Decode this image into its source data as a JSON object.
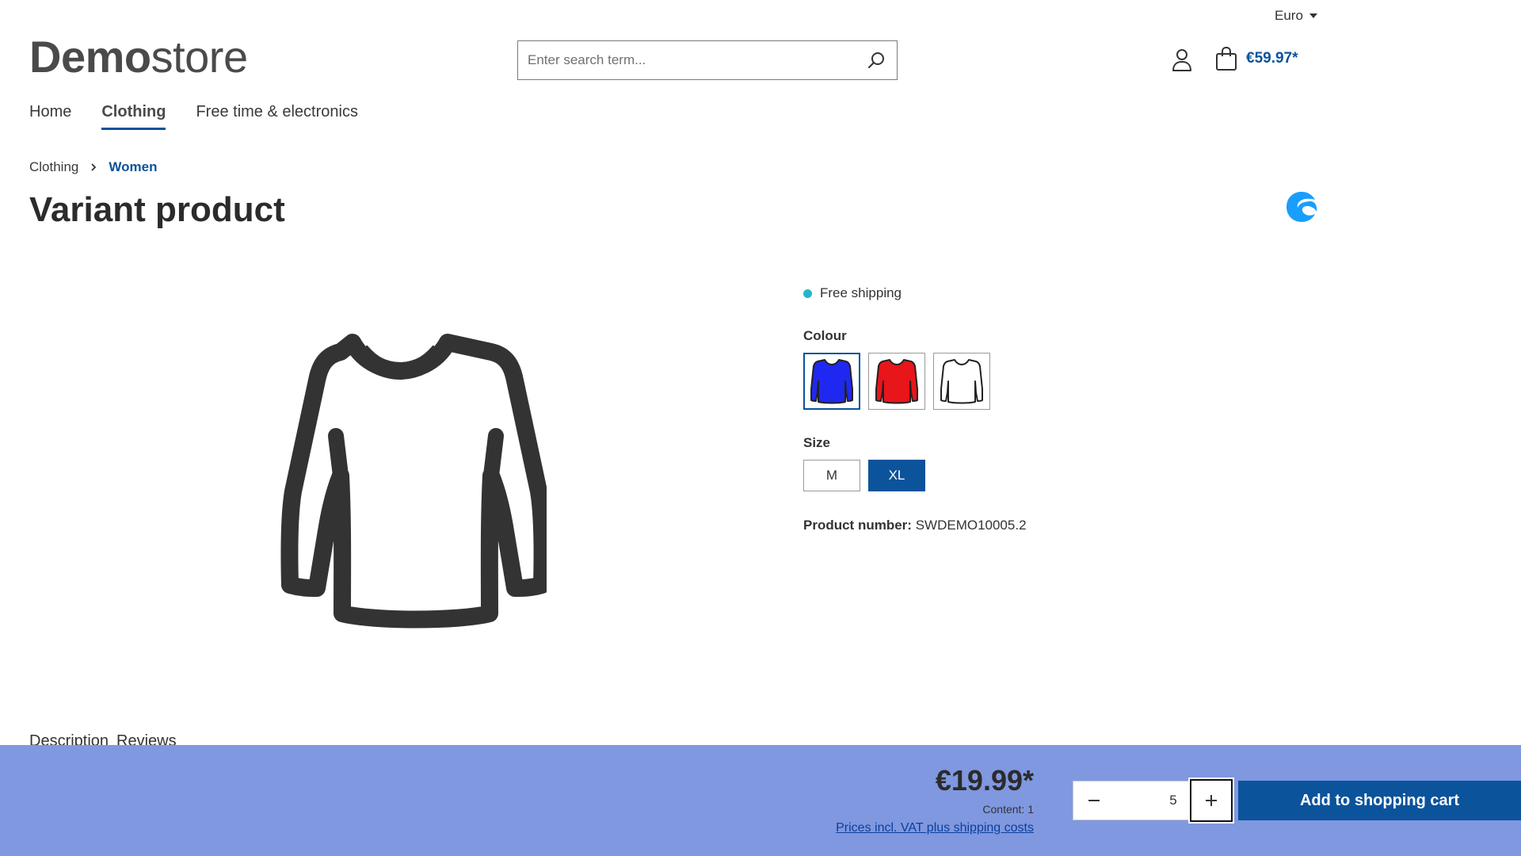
{
  "header": {
    "currency_label": "Euro",
    "logo_bold": "Demo",
    "logo_light": "store",
    "search_placeholder": "Enter search term...",
    "cart_total": "€59.97*"
  },
  "nav": {
    "items": [
      {
        "label": "Home"
      },
      {
        "label": "Clothing",
        "active": true
      },
      {
        "label": "Free time & electronics"
      }
    ]
  },
  "breadcrumb": {
    "items": [
      {
        "label": "Clothing"
      },
      {
        "label": "Women",
        "current": true
      }
    ]
  },
  "product": {
    "title": "Variant product",
    "shipping_label": "Free shipping",
    "colour_label": "Colour",
    "colour_options": [
      {
        "name": "blue",
        "color": "#1f28f0",
        "selected": true
      },
      {
        "name": "red",
        "color": "#e8151b",
        "selected": false
      },
      {
        "name": "white",
        "color": "#ffffff",
        "selected": false
      }
    ],
    "size_label": "Size",
    "size_options": [
      {
        "label": "M",
        "selected": false
      },
      {
        "label": "XL",
        "selected": true
      }
    ],
    "product_number_label": "Product number:",
    "product_number": "SWDEMO10005.2"
  },
  "tabs": {
    "description": "Description",
    "reviews": "Reviews"
  },
  "buybar": {
    "price": "€19.99*",
    "content": "Content: 1",
    "vat_link": "Prices incl. VAT plus shipping costs",
    "quantity": "5",
    "add_to_cart": "Add to shopping cart"
  },
  "colors": {
    "accent": "#0b539b",
    "buybar_bg": "#7f98e0",
    "shipping_dot": "#26b4cc",
    "manufacturer_logo": "#189eff"
  },
  "icons": {
    "search": "search-icon",
    "account": "user-icon",
    "cart": "shopping-bag-icon",
    "breadcrumb_separator": "chevron-right-icon",
    "quantity_minus": "minus-icon",
    "quantity_plus": "plus-icon",
    "product_image": "long-sleeve-shirt-icon",
    "manufacturer": "shopware-logo"
  }
}
